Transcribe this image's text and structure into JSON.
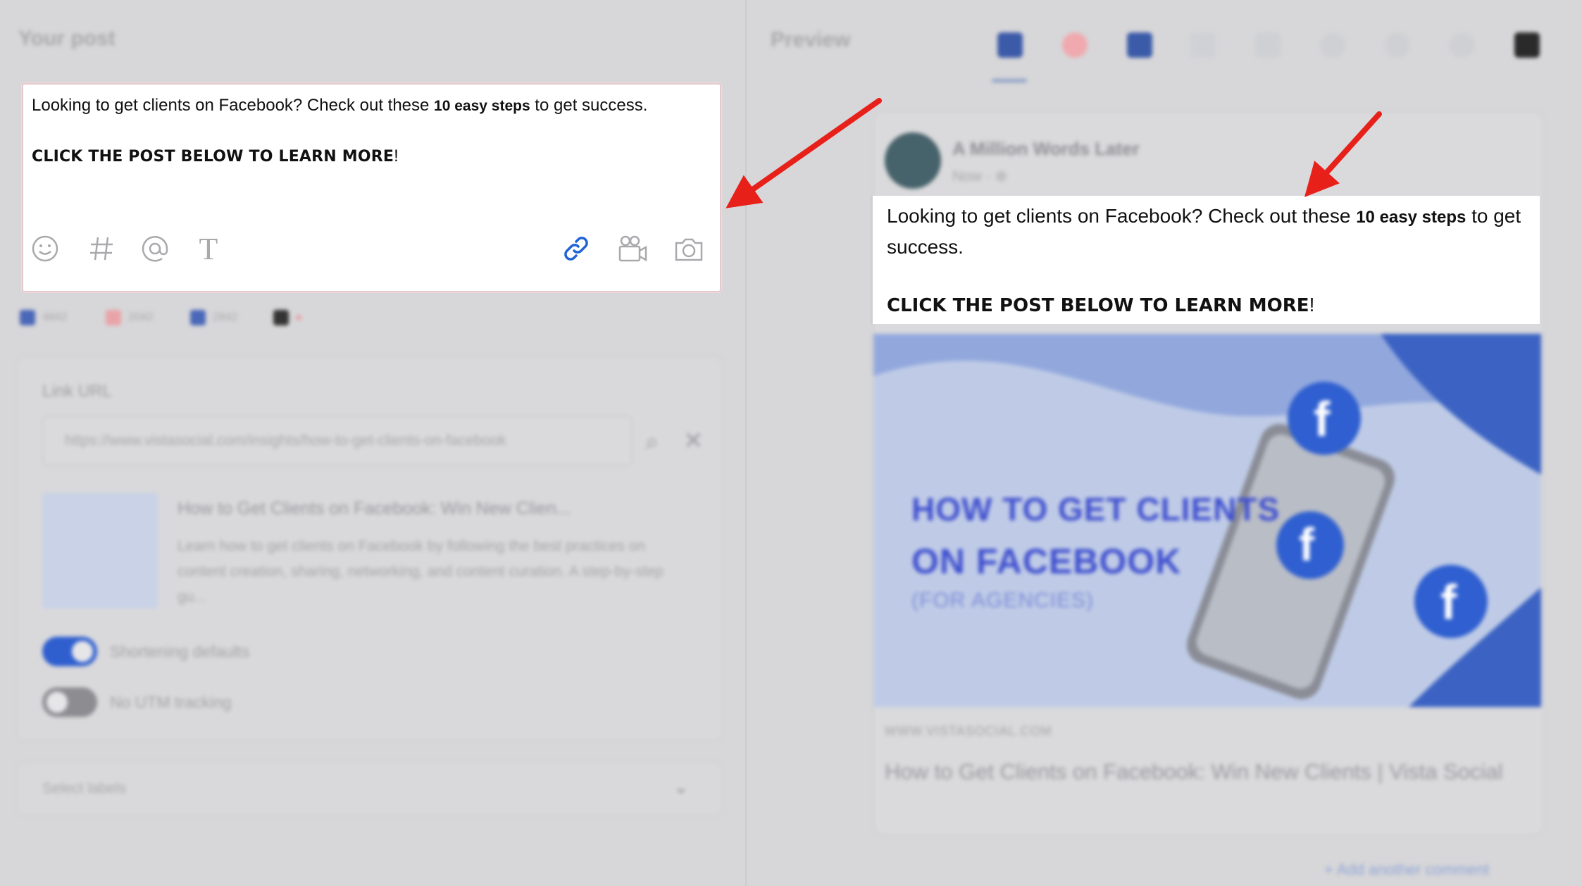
{
  "left": {
    "title": "Your post",
    "editor": {
      "text_before": "Looking to get clients on Facebook? Check out these ",
      "text_bold": "10 easy steps",
      "text_after": " to get success.",
      "cta": "CLICK THE POST BELOW TO LEARN MORE",
      "cta_end": "!",
      "icons": [
        "emoji-icon",
        "hashtag-icon",
        "mention-icon",
        "text-format-icon",
        "link-icon",
        "video-icon",
        "camera-icon"
      ]
    },
    "counts": [
      {
        "network": "facebook",
        "value": "4842",
        "color": "#4a67b8"
      },
      {
        "network": "instagram",
        "value": "2042",
        "color": "#e9a3a8"
      },
      {
        "network": "linkedin",
        "value": "2842",
        "color": "#4a67b8"
      },
      {
        "network": "tiktok",
        "value": "",
        "color": "#333333"
      }
    ],
    "link_section": {
      "label": "Link URL",
      "url_value": "https://www.vistasocial.com/insights/how-to-get-clients-on-facebook",
      "preview_title": "How to Get Clients on Facebook: Win New Clien...",
      "preview_desc": "Learn how to get clients on Facebook by following the best practices on content creation, sharing, networking, and content curation. A step-by-step gu...",
      "toggle_shortening_label": "Shortening defaults",
      "toggle_shortening_on": true,
      "toggle_utm_label": "No UTM tracking",
      "toggle_utm_on": false
    },
    "labels_select": {
      "placeholder": "Select labels"
    }
  },
  "right": {
    "title": "Preview",
    "networks": [
      {
        "icon": "facebook-icon",
        "color": "#3b5aa8",
        "selected": true
      },
      {
        "icon": "instagram-icon",
        "color": "#f0a9ae",
        "selected": false
      },
      {
        "icon": "linkedin-icon",
        "color": "#3b5aa8",
        "selected": false
      },
      {
        "icon": "twitter-icon",
        "color": "#cfd1d6",
        "selected": false
      },
      {
        "icon": "youtube-icon",
        "color": "#cfd0d3",
        "selected": false
      },
      {
        "icon": "google-icon",
        "color": "#cfd0d3",
        "selected": false
      },
      {
        "icon": "pinterest-icon",
        "color": "#cfd0d3",
        "selected": false
      },
      {
        "icon": "reddit-icon",
        "color": "#cfd0d3",
        "selected": false
      },
      {
        "icon": "tiktok-icon",
        "color": "#2a2a2a",
        "selected": false
      }
    ],
    "post": {
      "page_name": "A Million Words Later",
      "time": "Now · ⊕",
      "text_before": "Looking to get clients on Facebook? Check out these ",
      "text_bold": "10 easy steps",
      "text_after": " to get success.",
      "cta": "CLICK THE POST BELOW TO LEARN MORE",
      "cta_end": "!",
      "image_title_line1": "HOW TO GET CLIENTS",
      "image_title_line2": "ON FACEBOOK",
      "image_subtitle": "(FOR AGENCIES)",
      "domain": "WWW.VISTASOCIAL.COM",
      "link_title": "How to Get Clients on Facebook: Win New Clients | Vista Social",
      "add_comment": "+ Add another comment"
    }
  },
  "colors": {
    "background": "#d7d7d9",
    "arrow": "#e8201a",
    "accent_blue": "#1f63d6"
  }
}
